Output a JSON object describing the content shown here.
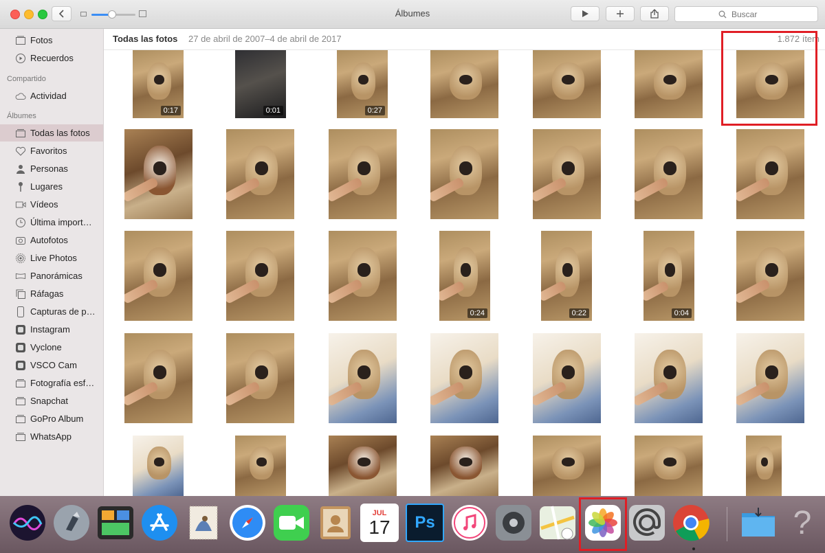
{
  "window": {
    "title": "Álbumes",
    "search_placeholder": "Buscar"
  },
  "sidebar": {
    "items": [
      {
        "label": "Fotos",
        "icon": "photos-icon"
      },
      {
        "label": "Recuerdos",
        "icon": "memories-icon"
      }
    ],
    "shared_header": "Compartido",
    "shared": [
      {
        "label": "Actividad",
        "icon": "cloud-icon"
      }
    ],
    "albums_header": "Álbumes",
    "albums": [
      {
        "label": "Todas las fotos",
        "icon": "album-icon"
      },
      {
        "label": "Favoritos",
        "icon": "heart-icon"
      },
      {
        "label": "Personas",
        "icon": "person-icon"
      },
      {
        "label": "Lugares",
        "icon": "pin-icon"
      },
      {
        "label": "Vídeos",
        "icon": "video-icon"
      },
      {
        "label": "Última import…",
        "icon": "clock-icon"
      },
      {
        "label": "Autofotos",
        "icon": "selfie-icon"
      },
      {
        "label": "Live Photos",
        "icon": "live-photo-icon"
      },
      {
        "label": "Panorámicas",
        "icon": "panorama-icon"
      },
      {
        "label": "Ráfagas",
        "icon": "burst-icon"
      },
      {
        "label": "Capturas de p…",
        "icon": "phone-icon"
      },
      {
        "label": "Instagram",
        "icon": "app-icon"
      },
      {
        "label": "Vyclone",
        "icon": "app-icon"
      },
      {
        "label": "VSCO Cam",
        "icon": "app-icon"
      },
      {
        "label": "Fotografía esf…",
        "icon": "album-icon"
      },
      {
        "label": "Snapchat",
        "icon": "album-icon"
      },
      {
        "label": "GoPro Album",
        "icon": "album-icon"
      },
      {
        "label": "WhatsApp",
        "icon": "album-icon"
      }
    ],
    "selected_album": "Todas las fotos"
  },
  "content": {
    "title": "Todas las fotos",
    "date_range": "27 de abril de 2007–4 de abril de 2017",
    "count": "1.872 ítem"
  },
  "thumbnails": [
    {
      "kind": "sand",
      "duration": "0:17"
    },
    {
      "kind": "dark",
      "duration": "0:01"
    },
    {
      "kind": "sand",
      "duration": "0:27"
    },
    {
      "kind": "sand"
    },
    {
      "kind": "sand"
    },
    {
      "kind": "sand"
    },
    {
      "kind": "sand",
      "highlighted": true
    },
    {
      "kind": "brown"
    },
    {
      "kind": "sand"
    },
    {
      "kind": "sand"
    },
    {
      "kind": "sand"
    },
    {
      "kind": "sand"
    },
    {
      "kind": "sand"
    },
    {
      "kind": "sand"
    },
    {
      "kind": "sand"
    },
    {
      "kind": "sand"
    },
    {
      "kind": "sand"
    },
    {
      "kind": "sand",
      "duration": "0:24"
    },
    {
      "kind": "sand",
      "duration": "0:22"
    },
    {
      "kind": "sand",
      "duration": "0:04"
    },
    {
      "kind": "sand"
    },
    {
      "kind": "sand"
    },
    {
      "kind": "sand"
    },
    {
      "kind": "light"
    },
    {
      "kind": "light"
    },
    {
      "kind": "light"
    },
    {
      "kind": "light"
    },
    {
      "kind": "light"
    },
    {
      "kind": "light"
    },
    {
      "kind": "sand"
    },
    {
      "kind": "brown"
    },
    {
      "kind": "brown"
    },
    {
      "kind": "sand"
    },
    {
      "kind": "sand"
    },
    {
      "kind": "sand"
    }
  ],
  "dock": {
    "apps": [
      {
        "name": "siri-icon"
      },
      {
        "name": "launchpad-icon"
      },
      {
        "name": "mission-control-icon"
      },
      {
        "name": "app-store-icon"
      },
      {
        "name": "mail-stamp-icon"
      },
      {
        "name": "safari-icon"
      },
      {
        "name": "facetime-icon"
      },
      {
        "name": "contacts-icon"
      },
      {
        "name": "calendar-icon",
        "month": "JUL",
        "day": "17"
      },
      {
        "name": "photoshop-icon",
        "text": "Ps"
      },
      {
        "name": "itunes-icon"
      },
      {
        "name": "system-preferences-icon"
      },
      {
        "name": "maps-icon"
      },
      {
        "name": "photos-app-icon",
        "highlighted": true
      },
      {
        "name": "mail-at-icon"
      },
      {
        "name": "chrome-icon"
      },
      {
        "name": "downloads-folder-icon"
      },
      {
        "name": "help-icon",
        "text": "?"
      }
    ]
  },
  "colors": {
    "highlight": "#e01e25",
    "sidebar_selected": "#dccccf",
    "accent": "#3b8ef5"
  }
}
